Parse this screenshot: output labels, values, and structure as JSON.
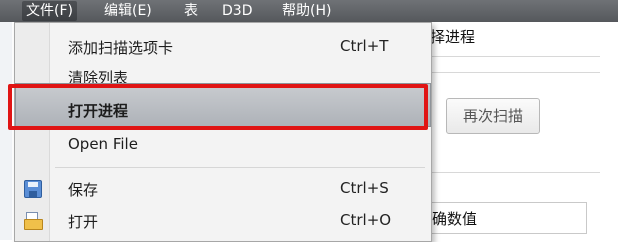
{
  "menubar": {
    "items": [
      {
        "label": "文件(F)"
      },
      {
        "label": "编辑(E)"
      },
      {
        "label": "表"
      },
      {
        "label": "D3D"
      },
      {
        "label": "帮助(H)"
      }
    ]
  },
  "background": {
    "select_process_partial": "择进程",
    "rescan_button": "再次扫描",
    "value_partial": "确数值"
  },
  "file_menu": {
    "items": [
      {
        "label": "添加扫描选项卡",
        "shortcut": "Ctrl+T"
      },
      {
        "label": "清除列表",
        "shortcut": ""
      },
      {
        "label": "打开进程",
        "shortcut": ""
      },
      {
        "label": "Open File",
        "shortcut": ""
      },
      {
        "label": "保存",
        "shortcut": "Ctrl+S",
        "icon": "save-icon"
      },
      {
        "label": "打开",
        "shortcut": "Ctrl+O",
        "icon": "open-folder-icon"
      }
    ],
    "highlight_color": "#e01414"
  }
}
